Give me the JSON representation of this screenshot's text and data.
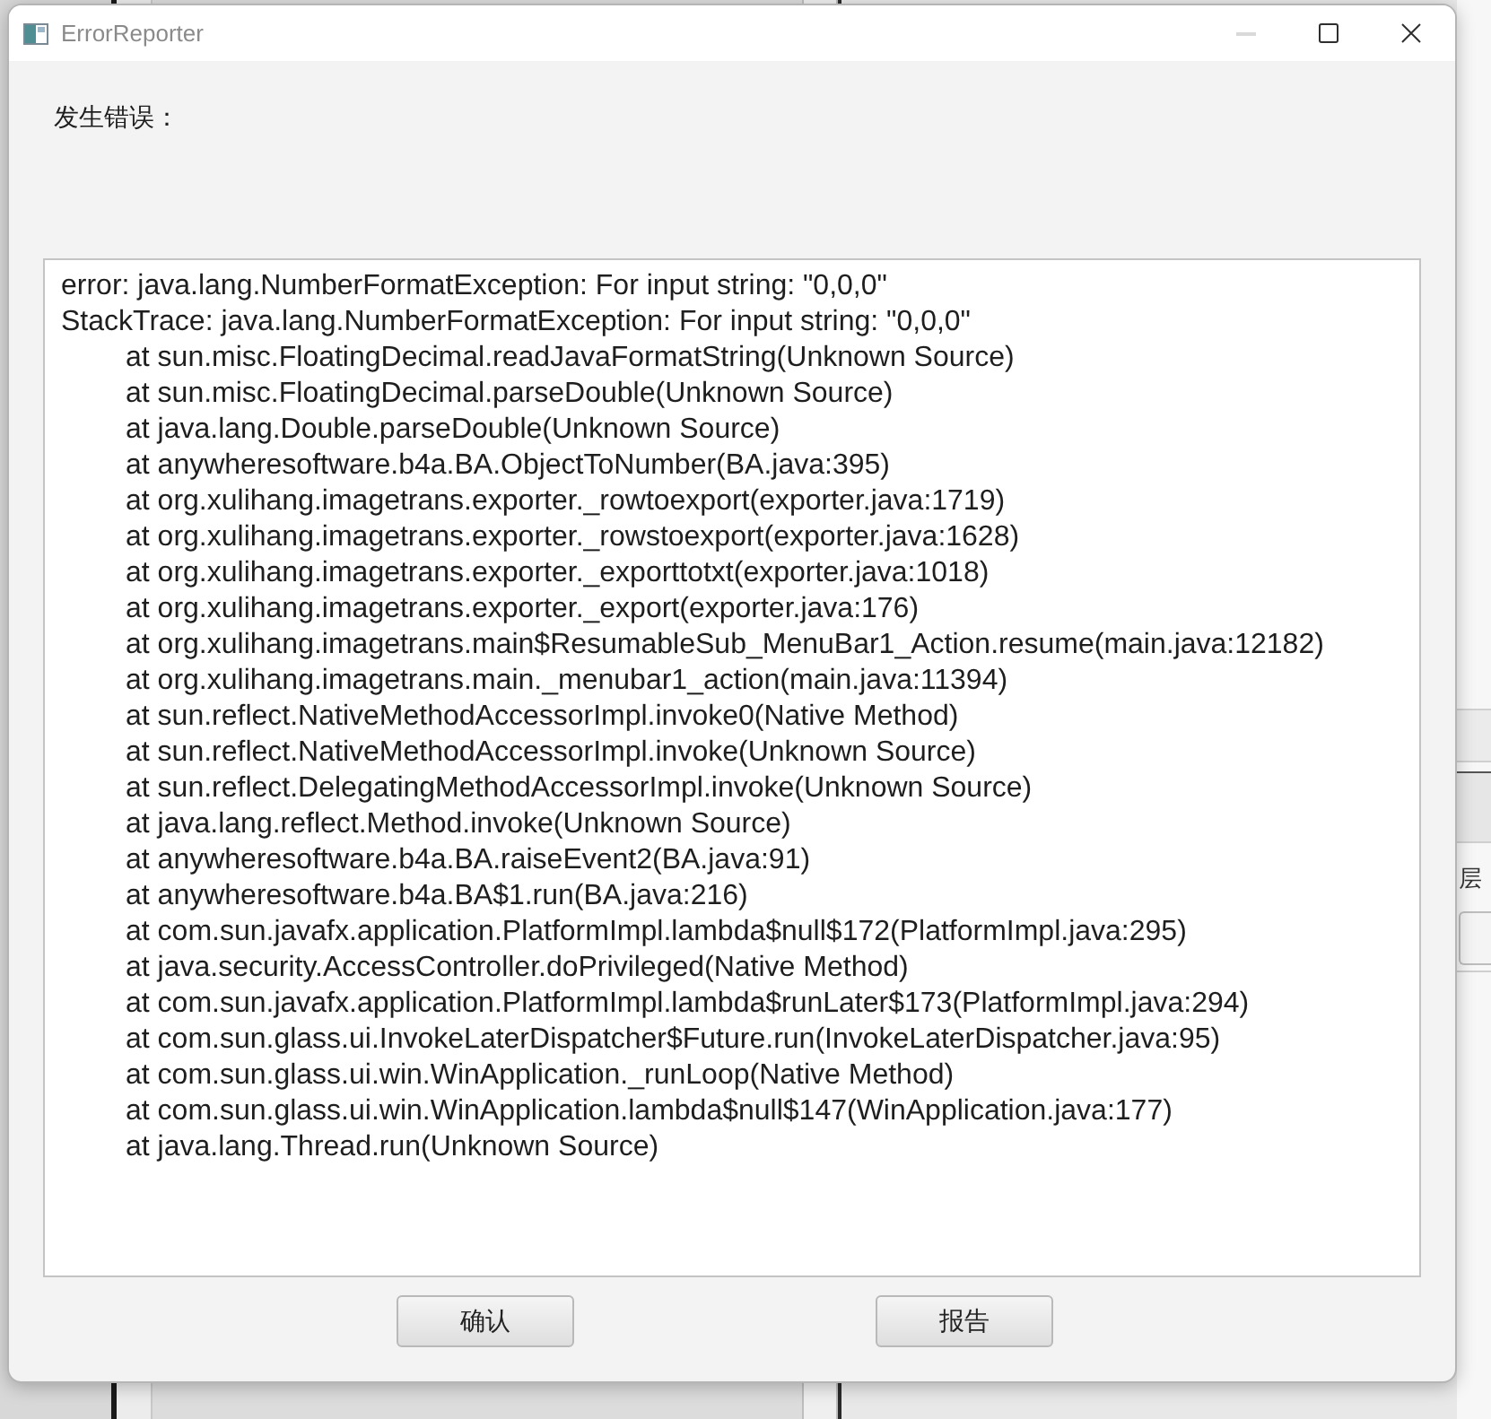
{
  "window": {
    "title": "ErrorReporter",
    "controls": [
      {
        "kind": "minimize",
        "disabled": true
      },
      {
        "kind": "maximize",
        "disabled": false
      },
      {
        "kind": "close",
        "disabled": false
      }
    ]
  },
  "message_label": "发生错误：",
  "error_text": {
    "lines": [
      {
        "text": "error: java.lang.NumberFormatException: For input string: \"0,0,0\"",
        "indented": false
      },
      {
        "text": "StackTrace: java.lang.NumberFormatException: For input string: \"0,0,0\"",
        "indented": false
      },
      {
        "text": "at sun.misc.FloatingDecimal.readJavaFormatString(Unknown Source)",
        "indented": true
      },
      {
        "text": "at sun.misc.FloatingDecimal.parseDouble(Unknown Source)",
        "indented": true
      },
      {
        "text": "at java.lang.Double.parseDouble(Unknown Source)",
        "indented": true
      },
      {
        "text": "at anywheresoftware.b4a.BA.ObjectToNumber(BA.java:395)",
        "indented": true
      },
      {
        "text": "at org.xulihang.imagetrans.exporter._rowtoexport(exporter.java:1719)",
        "indented": true
      },
      {
        "text": "at org.xulihang.imagetrans.exporter._rowstoexport(exporter.java:1628)",
        "indented": true
      },
      {
        "text": "at org.xulihang.imagetrans.exporter._exporttotxt(exporter.java:1018)",
        "indented": true
      },
      {
        "text": "at org.xulihang.imagetrans.exporter._export(exporter.java:176)",
        "indented": true
      },
      {
        "text": "at org.xulihang.imagetrans.main$ResumableSub_MenuBar1_Action.resume(main.java:12182)",
        "indented": true
      },
      {
        "text": "at org.xulihang.imagetrans.main._menubar1_action(main.java:11394)",
        "indented": true
      },
      {
        "text": "at sun.reflect.NativeMethodAccessorImpl.invoke0(Native Method)",
        "indented": true
      },
      {
        "text": "at sun.reflect.NativeMethodAccessorImpl.invoke(Unknown Source)",
        "indented": true
      },
      {
        "text": "at sun.reflect.DelegatingMethodAccessorImpl.invoke(Unknown Source)",
        "indented": true
      },
      {
        "text": "at java.lang.reflect.Method.invoke(Unknown Source)",
        "indented": true
      },
      {
        "text": "at anywheresoftware.b4a.BA.raiseEvent2(BA.java:91)",
        "indented": true
      },
      {
        "text": "at anywheresoftware.b4a.BA$1.run(BA.java:216)",
        "indented": true
      },
      {
        "text": "at com.sun.javafx.application.PlatformImpl.lambda$null$172(PlatformImpl.java:295)",
        "indented": true
      },
      {
        "text": "at java.security.AccessController.doPrivileged(Native Method)",
        "indented": true
      },
      {
        "text": "at com.sun.javafx.application.PlatformImpl.lambda$runLater$173(PlatformImpl.java:294)",
        "indented": true
      },
      {
        "text": "at com.sun.glass.ui.InvokeLaterDispatcher$Future.run(InvokeLaterDispatcher.java:95)",
        "indented": true
      },
      {
        "text": "at com.sun.glass.ui.win.WinApplication._runLoop(Native Method)",
        "indented": true
      },
      {
        "text": "at com.sun.glass.ui.win.WinApplication.lambda$null$147(WinApplication.java:177)",
        "indented": true
      },
      {
        "text": "at java.lang.Thread.run(Unknown Source)",
        "indented": true
      }
    ]
  },
  "buttons": [
    {
      "label": "确认"
    },
    {
      "label": "报告"
    }
  ],
  "background_window": {
    "label": "层"
  }
}
